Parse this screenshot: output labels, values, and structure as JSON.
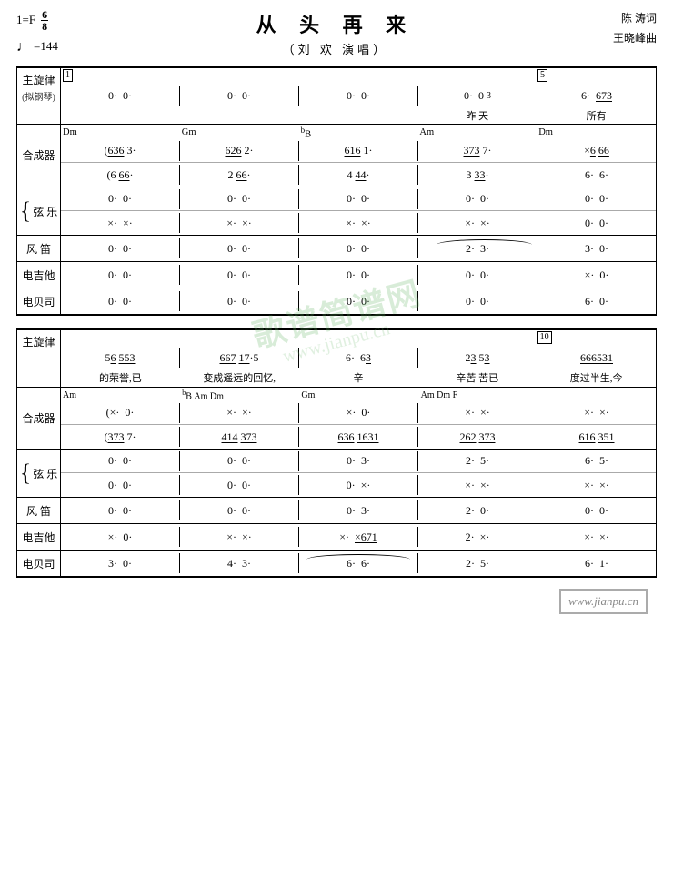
{
  "header": {
    "key": "1=F",
    "meter_top": "6",
    "meter_bottom": "8",
    "tempo_value": "=144",
    "title": "从 头 再 来",
    "subtitle": "（刘  欢 演唱）",
    "credit1": "陈  涛词",
    "credit2": "王晓峰曲"
  },
  "watermark": {
    "line1": "歌谱简谱网",
    "line2": "www.jianpu.cn"
  },
  "section1": {
    "measure_numbers": [
      "1",
      "5"
    ],
    "rows": [
      {
        "label": "主旋律",
        "sub_label": "(拟钢琴)",
        "measures": [
          "0.  0.",
          "0.  0.",
          "0.  0.",
          "0.  0  3",
          "6.   673̲"
        ],
        "lyrics": [
          "",
          "",
          "",
          "昨  天",
          "所有"
        ]
      },
      {
        "label": "合成器",
        "chord_row": [
          "Dm",
          "Gm",
          "♭B",
          "Am",
          "Dm"
        ],
        "line1": [
          "(636  3.",
          "626̲  2.",
          "616  1.",
          "373  7.",
          "×6̲  66"
        ],
        "line2": [
          "(6  6̲6.",
          "2  6̲6.",
          "4  4̲4.",
          "3  3̲3.",
          "6.  6."
        ]
      },
      {
        "label": "弦  乐",
        "line1": [
          "0.  0.",
          "0.  0.",
          "0.  0.",
          "0.  0.",
          "0.  0."
        ],
        "line2": [
          "×.  ×.",
          "×.  ×.",
          "×.  ×.",
          "×.  ×.",
          "0.  0."
        ]
      },
      {
        "label": "风  笛",
        "measures": [
          "0.  0.",
          "0.  0.",
          "0.  0.",
          "2.  3.",
          "3.  0."
        ]
      },
      {
        "label": "电吉他",
        "measures": [
          "0.  0.",
          "0.  0.",
          "0.  0.",
          "0.  0.",
          "×.  0."
        ]
      },
      {
        "label": "电贝司",
        "measures": [
          "0.  0.",
          "0.  0.",
          "0.  0.",
          "0.  0.",
          "6.  0."
        ]
      }
    ]
  },
  "section2": {
    "measure_numbers": [
      "10"
    ],
    "rows": [
      {
        "label": "主旋律",
        "measures": [
          "5 6̲  5̲5̲3̲",
          "6̲6̲7  1̲7·5",
          "6·  6 3̲",
          "2 3̲  5 3̲",
          "6̲6̲6̲5̲3̲1̲"
        ],
        "lyrics": [
          "的荣誉,已",
          "变成遥远的回忆,",
          "辛",
          "辛苦  苦已",
          "度过半生,今"
        ]
      },
      {
        "label": "合成器",
        "chord_row": [
          "Am",
          "♭B  Am  Dm",
          "Gm  Am  Dm  F"
        ],
        "line1": [
          "(×.  0.",
          "×.  ×.",
          "×.  0.",
          "×.  ×.",
          "×.  ×."
        ],
        "line2": [
          "(373  7.",
          "414  373",
          "636  1631",
          "262  373",
          "616  351"
        ]
      },
      {
        "label": "弦  乐",
        "line1": [
          "0.  0.",
          "0.  0.",
          "0.  3.",
          "2.  5.",
          "6.  5."
        ],
        "line2": [
          "0.  0.",
          "0.  0.",
          "0.  ×.",
          "×.  ×.",
          "×.  ×."
        ]
      },
      {
        "label": "风  笛",
        "measures": [
          "0.  0.",
          "0.  0.",
          "0.  3.",
          "2.  0.",
          "0.  0."
        ]
      },
      {
        "label": "电吉他",
        "measures": [
          "×.  0.",
          "×.  ×.",
          "×.  x̲6̲7̲1̲",
          "2.  ×.",
          "×.  ×."
        ]
      },
      {
        "label": "电贝司",
        "measures": [
          "3.  0.",
          "4.  3.",
          "6.  6.",
          "2.  5.",
          "6.  1."
        ]
      }
    ]
  },
  "footer": {
    "watermark_url": "www.jianpu.cn"
  }
}
